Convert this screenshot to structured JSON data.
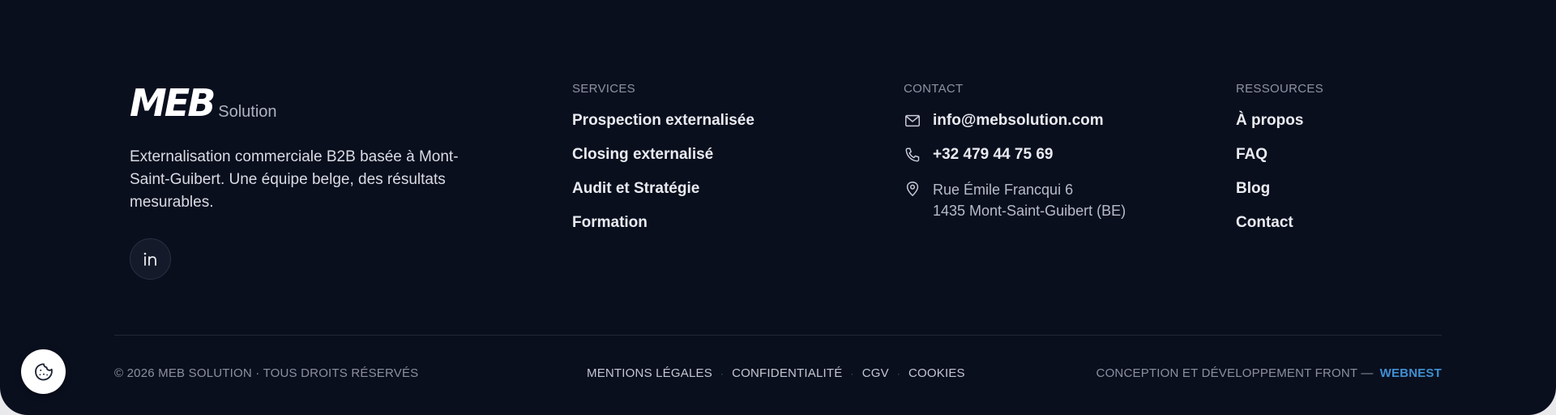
{
  "brand": {
    "logo_mark": "MEB",
    "logo_sub": "Solution",
    "tagline_line1": "Externalisation commerciale B2B basée à Mont-",
    "tagline_line2": "Saint-Guibert. Une équipe belge, des résultats",
    "tagline_line3": "mesurables.",
    "social_icon": "linkedin-icon"
  },
  "services": {
    "title": "SERVICES",
    "items": [
      {
        "label": "Prospection externalisée"
      },
      {
        "label": "Closing externalisé"
      },
      {
        "label": "Audit et Stratégie"
      },
      {
        "label": "Formation"
      }
    ]
  },
  "contact": {
    "title": "CONTACT",
    "email": "info@mebsolution.com",
    "phone": "+32 479 44 75 69",
    "address_line1": "Rue Émile Francqui 6",
    "address_line2": "1435 Mont-Saint-Guibert (BE)",
    "icons": [
      "mail-icon",
      "phone-icon",
      "map-pin-icon"
    ]
  },
  "resources": {
    "title": "RESSOURCES",
    "items": [
      {
        "label": "À propos"
      },
      {
        "label": "FAQ"
      },
      {
        "label": "Blog"
      },
      {
        "label": "Contact"
      }
    ]
  },
  "footer": {
    "copyright": "© 2026 MEB SOLUTION · TOUS DROITS RÉSERVÉS",
    "legal": [
      {
        "label": "MENTIONS LÉGALES"
      },
      {
        "label": "CONFIDENTIALITÉ"
      },
      {
        "label": "CGV"
      },
      {
        "label": "COOKIES"
      }
    ],
    "separator": "·",
    "credit_prefix": "CONCEPTION ET DÉVELOPPEMENT FRONT —",
    "credit_link": "WEBNEST"
  },
  "cookie_button": {
    "icon": "cookie-icon"
  },
  "colors": {
    "background": "#0a0f1e",
    "accent": "#3f8fd1",
    "text": "#e9ebf1",
    "muted": "#8b909f"
  }
}
